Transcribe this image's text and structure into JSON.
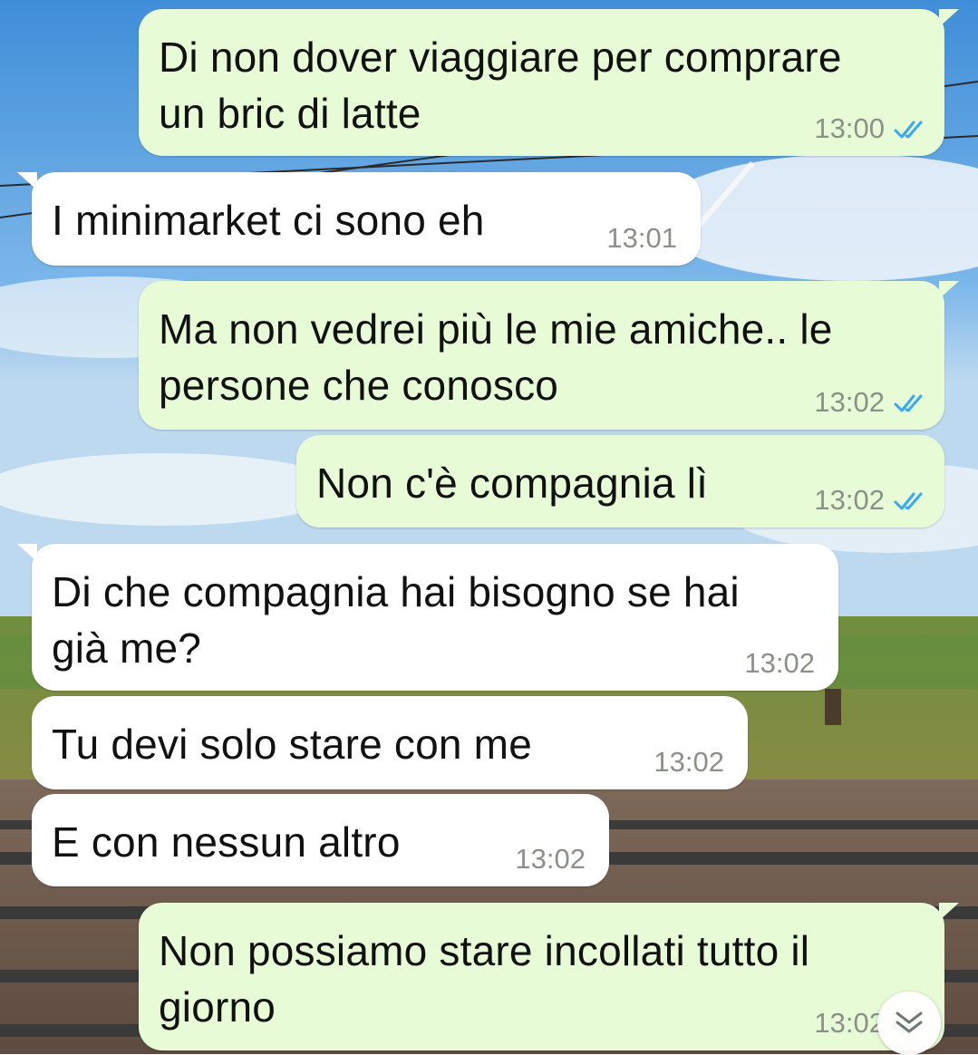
{
  "colors": {
    "outgoing_bubble": "#e7fcd6",
    "incoming_bubble": "#ffffff",
    "read_ticks": "#3aa8f0",
    "timestamp": "#8a9188"
  },
  "messages": [
    {
      "direction": "outgoing",
      "text": "Di non dover viaggiare per comprare\nun bric di latte",
      "time": "13:00",
      "status": "read"
    },
    {
      "direction": "incoming",
      "text": "I minimarket ci sono eh",
      "time": "13:01"
    },
    {
      "direction": "outgoing",
      "text": "Ma non vedrei più le mie amiche.. le\npersone che conosco",
      "time": "13:02",
      "status": "read"
    },
    {
      "direction": "outgoing",
      "text": "Non c'è compagnia lì",
      "time": "13:02",
      "status": "read"
    },
    {
      "direction": "incoming",
      "text": "Di che compagnia hai bisogno se hai\ngià me?",
      "time": "13:02"
    },
    {
      "direction": "incoming",
      "text": "Tu devi solo stare con me",
      "time": "13:02"
    },
    {
      "direction": "incoming",
      "text": "E con nessun altro",
      "time": "13:02"
    },
    {
      "direction": "outgoing",
      "text": "Non possiamo stare incollati tutto il\ngiorno",
      "time": "13:02",
      "status": "read"
    }
  ],
  "icons": {
    "read_status": "double-check-icon",
    "scroll_down": "chevron-double-down-icon"
  }
}
